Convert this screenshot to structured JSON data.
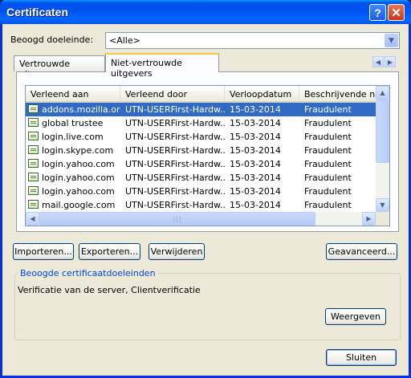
{
  "window": {
    "title": "Certificaten"
  },
  "titlebar": {
    "help_glyph": "?",
    "close_glyph": "✕"
  },
  "purpose": {
    "label": "Beoogd doeleinde:",
    "value": "<Alle>"
  },
  "tabs": [
    {
      "label": "Vertrouwde uitgevers",
      "active": false
    },
    {
      "label": "Niet-vertrouwde uitgevers",
      "active": true
    }
  ],
  "tab_scroll": {
    "left": "◀",
    "right": "▶"
  },
  "table": {
    "columns": [
      "Verleend aan",
      "Verleend door",
      "Verloopdatum",
      "Beschrijvende naa"
    ],
    "rows": [
      {
        "issued_to": "addons.mozilla.org",
        "issued_by": "UTN-USERFirst-Hardw...",
        "expires": "15-03-2014",
        "friendly": "Fraudulent",
        "selected": true
      },
      {
        "issued_to": "global trustee",
        "issued_by": "UTN-USERFirst-Hardw...",
        "expires": "15-03-2014",
        "friendly": "Fraudulent"
      },
      {
        "issued_to": "login.live.com",
        "issued_by": "UTN-USERFirst-Hardw...",
        "expires": "15-03-2014",
        "friendly": "Fraudulent"
      },
      {
        "issued_to": "login.skype.com",
        "issued_by": "UTN-USERFirst-Hardw...",
        "expires": "15-03-2014",
        "friendly": "Fraudulent"
      },
      {
        "issued_to": "login.yahoo.com",
        "issued_by": "UTN-USERFirst-Hardw...",
        "expires": "15-03-2014",
        "friendly": "Fraudulent"
      },
      {
        "issued_to": "login.yahoo.com",
        "issued_by": "UTN-USERFirst-Hardw...",
        "expires": "15-03-2014",
        "friendly": "Fraudulent"
      },
      {
        "issued_to": "login.yahoo.com",
        "issued_by": "UTN-USERFirst-Hardw...",
        "expires": "15-03-2014",
        "friendly": "Fraudulent"
      },
      {
        "issued_to": "mail.google.com",
        "issued_by": "UTN-USERFirst-Hardw...",
        "expires": "15-03-2014",
        "friendly": "Fraudulent"
      }
    ]
  },
  "buttons": {
    "import": "Importeren...",
    "export": "Exporteren...",
    "remove": "Verwijderen",
    "advanced": "Geavanceerd...",
    "view": "Weergeven",
    "close": "Sluiten"
  },
  "purposes_group": {
    "title": "Beoogde certificaatdoeleinden",
    "text": "Verificatie van de server, Clientverificatie"
  },
  "colors": {
    "selection": "#316ac5",
    "titlebar": "#0058ee",
    "face": "#ece9d8",
    "group_title": "#0046d5"
  }
}
